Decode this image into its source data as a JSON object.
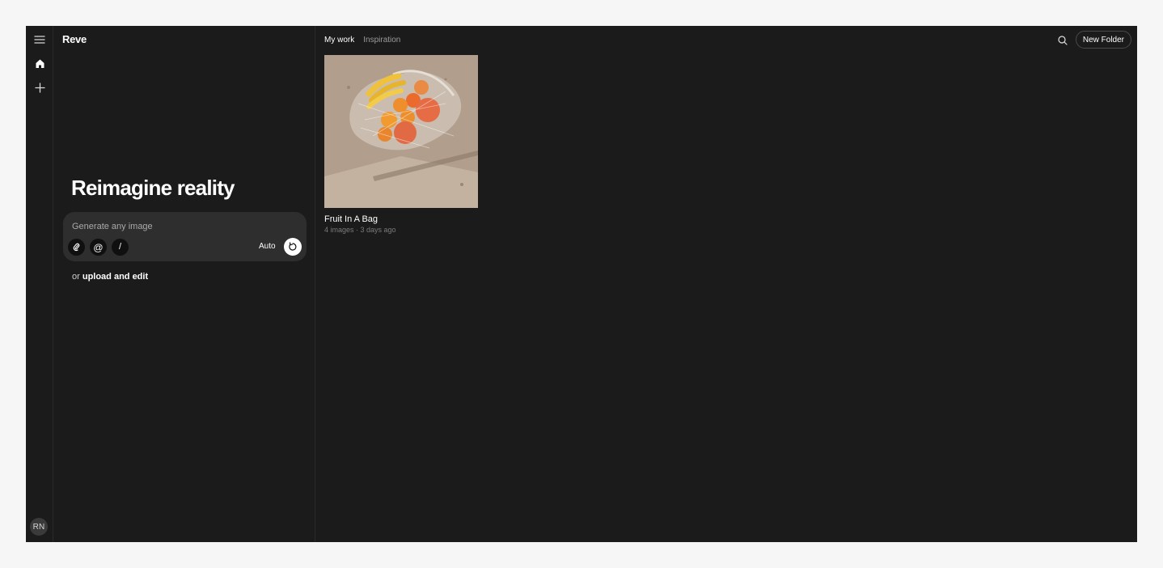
{
  "app": {
    "logo": "Reve",
    "avatar_initials": "RN"
  },
  "rail": {
    "icons": [
      "menu-icon",
      "home-icon",
      "plus-icon"
    ]
  },
  "left_panel": {
    "hero_title": "Reimagine reality",
    "prompt": {
      "placeholder": "Generate any image",
      "value": "",
      "mode_label": "Auto",
      "tools": [
        "attach-icon",
        "at-icon",
        "slash-icon"
      ]
    },
    "upload": {
      "prefix": "or",
      "link_label": "upload and edit"
    }
  },
  "main": {
    "tabs": [
      {
        "label": "My work",
        "active": true
      },
      {
        "label": "Inspiration",
        "active": false
      }
    ],
    "new_folder_label": "New Folder",
    "folders": [
      {
        "title": "Fruit In A Bag",
        "meta": "4 images · 3 days ago"
      }
    ]
  },
  "colors": {
    "background": "#1b1b1b",
    "panel": "#2e2e2e",
    "accent": "#ffffff",
    "muted": "#9a9a9a"
  }
}
